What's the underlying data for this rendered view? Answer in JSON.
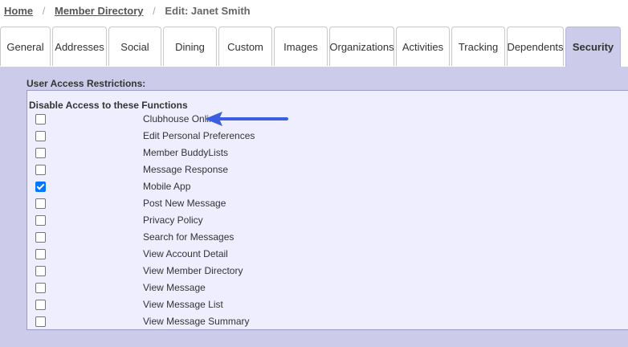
{
  "breadcrumb": {
    "home": "Home",
    "member_directory": "Member Directory",
    "separator": "/",
    "current": "Edit: Janet Smith"
  },
  "tabs": [
    {
      "label": "General"
    },
    {
      "label": "Addresses"
    },
    {
      "label": "Social"
    },
    {
      "label": "Dining"
    },
    {
      "label": "Custom"
    },
    {
      "label": "Images"
    },
    {
      "label": "Organizations"
    },
    {
      "label": "Activities"
    },
    {
      "label": "Tracking"
    },
    {
      "label": "Dependents"
    },
    {
      "label": "Security",
      "active": true
    }
  ],
  "security": {
    "section_title": "User Access Restrictions:",
    "box_title": "Disable Access to these Functions",
    "functions": [
      {
        "label": "Clubhouse Online",
        "checked": false
      },
      {
        "label": "Edit Personal Preferences",
        "checked": false
      },
      {
        "label": "Member BuddyLists",
        "checked": false
      },
      {
        "label": "Message Response",
        "checked": false
      },
      {
        "label": "Mobile App",
        "checked": true
      },
      {
        "label": "Post New Message",
        "checked": false
      },
      {
        "label": "Privacy Policy",
        "checked": false
      },
      {
        "label": "Search for Messages",
        "checked": false
      },
      {
        "label": "View Account Detail",
        "checked": false
      },
      {
        "label": "View Member Directory",
        "checked": false
      },
      {
        "label": "View Message",
        "checked": false
      },
      {
        "label": "View Message List",
        "checked": false
      },
      {
        "label": "View Message Summary",
        "checked": false
      }
    ]
  },
  "annotation": {
    "arrow_icon": "left-arrow-icon",
    "arrow_color": "#3b5fe0"
  },
  "colors": {
    "panel_bg": "#ccccea",
    "box_bg": "#eeeeff",
    "checkbox_checked": "#0075ff"
  }
}
